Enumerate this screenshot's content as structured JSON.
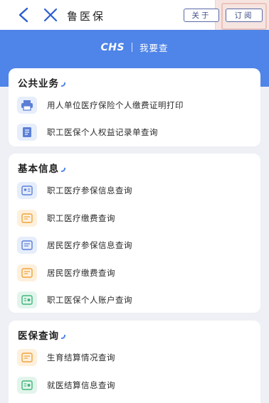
{
  "nav": {
    "title": "鲁医保",
    "about_label": "关于",
    "subscribe_label": "订阅"
  },
  "header": {
    "logo": "CHS",
    "subtitle": "我要查"
  },
  "sections": [
    {
      "title": "公共业务",
      "items": [
        {
          "label": "用人单位医疗保险个人缴费证明打印",
          "icon": "printer-icon",
          "tone": "blue"
        },
        {
          "label": "职工医保个人权益记录单查询",
          "icon": "document-icon",
          "tone": "blue"
        }
      ]
    },
    {
      "title": "基本信息",
      "items": [
        {
          "label": "职工医疗参保信息查询",
          "icon": "id-card-icon",
          "tone": "blue"
        },
        {
          "label": "职工医疗缴费查询",
          "icon": "payment-card-icon",
          "tone": "orange"
        },
        {
          "label": "居民医疗参保信息查询",
          "icon": "id-card-icon",
          "tone": "blue"
        },
        {
          "label": "居民医疗缴费查询",
          "icon": "payment-card-icon",
          "tone": "orange"
        },
        {
          "label": "职工医保个人账户查询",
          "icon": "account-card-icon",
          "tone": "green"
        }
      ]
    },
    {
      "title": "医保查询",
      "items": [
        {
          "label": "生育结算情况查询",
          "icon": "payment-card-icon",
          "tone": "orange"
        },
        {
          "label": "就医结算信息查询",
          "icon": "account-card-icon",
          "tone": "green"
        }
      ]
    }
  ],
  "colors": {
    "accent": "#4f84e8",
    "icon_blue": "#5b7fd6",
    "icon_orange": "#f0a33c",
    "icon_green": "#3fb67a"
  }
}
